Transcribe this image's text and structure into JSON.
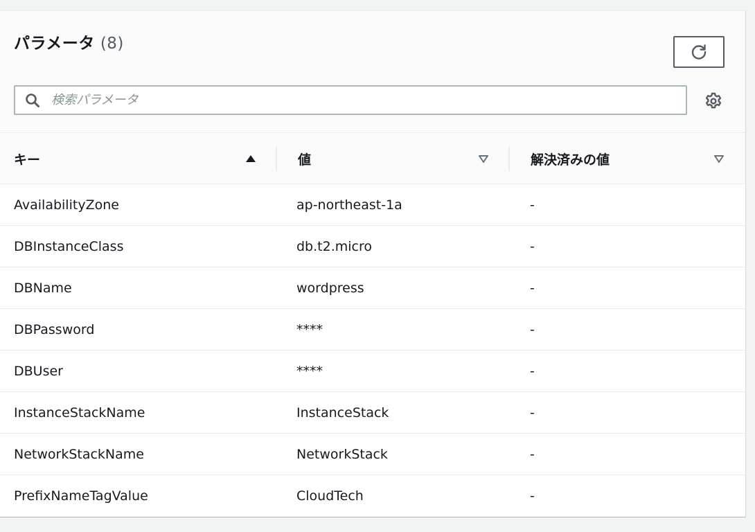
{
  "header": {
    "title": "パラメータ",
    "count": "(8)"
  },
  "search": {
    "placeholder": "検索パラメータ",
    "value": ""
  },
  "columns": [
    {
      "label": "キー",
      "sort": "ascending"
    },
    {
      "label": "値",
      "sort": "none"
    },
    {
      "label": "解決済みの値",
      "sort": "none"
    }
  ],
  "rows": [
    {
      "key": "AvailabilityZone",
      "value": "ap-northeast-1a",
      "resolved": "-"
    },
    {
      "key": "DBInstanceClass",
      "value": "db.t2.micro",
      "resolved": "-"
    },
    {
      "key": "DBName",
      "value": "wordpress",
      "resolved": "-"
    },
    {
      "key": "DBPassword",
      "value": "****",
      "resolved": "-"
    },
    {
      "key": "DBUser",
      "value": "****",
      "resolved": "-"
    },
    {
      "key": "InstanceStackName",
      "value": "InstanceStack",
      "resolved": "-"
    },
    {
      "key": "NetworkStackName",
      "value": "NetworkStack",
      "resolved": "-"
    },
    {
      "key": "PrefixNameTagValue",
      "value": "CloudTech",
      "resolved": "-"
    }
  ],
  "icons": {
    "refresh": "refresh-icon",
    "search": "search-icon",
    "settings": "gear-icon",
    "sort_asc": "sort-ascending-icon",
    "sort_none": "sort-descending-outline-icon"
  },
  "colors": {
    "text": "#16191f",
    "muted": "#545b64",
    "placeholder": "#879596",
    "border": "#aab7b8"
  }
}
